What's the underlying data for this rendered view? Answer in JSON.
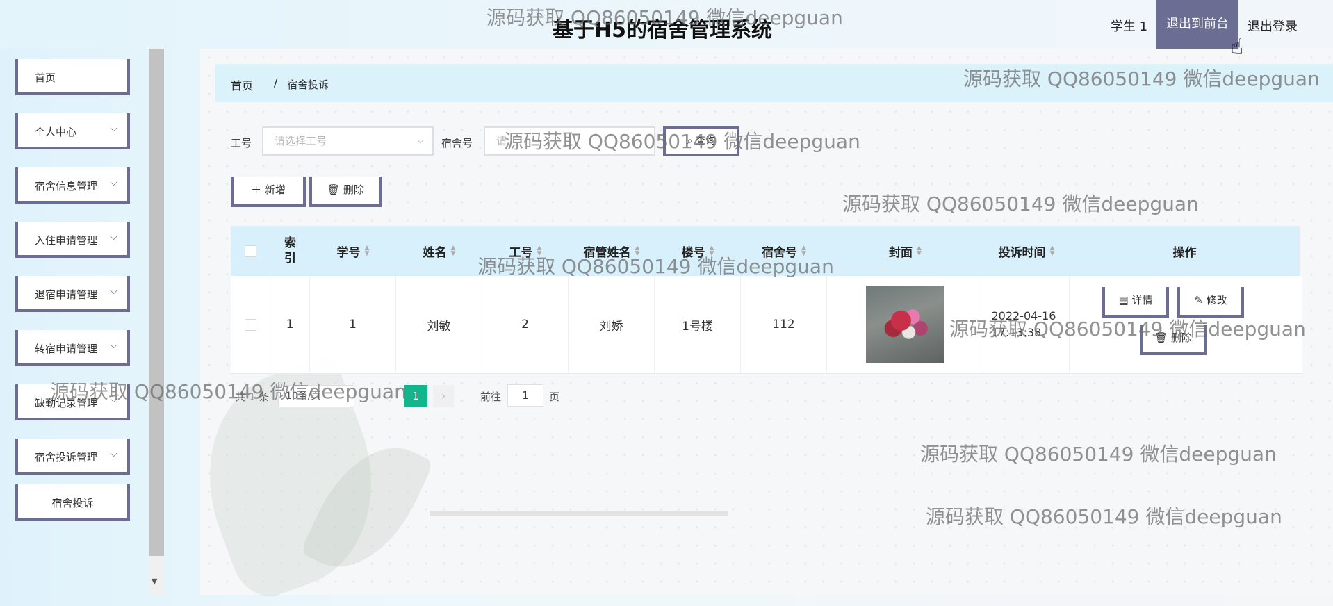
{
  "header": {
    "title": "基于H5的宿舍管理系统",
    "user": "学生 1",
    "front_label": "退出到前台",
    "logout_label": "退出登录"
  },
  "sidebar": {
    "items": [
      {
        "label": "首页",
        "has_chevron": false
      },
      {
        "label": "个人中心",
        "has_chevron": true
      },
      {
        "label": "宿舍信息管理",
        "has_chevron": true
      },
      {
        "label": "入住申请管理",
        "has_chevron": true
      },
      {
        "label": "退宿申请管理",
        "has_chevron": true
      },
      {
        "label": "转宿申请管理",
        "has_chevron": true
      },
      {
        "label": "缺勤记录管理",
        "has_chevron": true
      },
      {
        "label": "宿舍投诉管理",
        "has_chevron": true
      }
    ],
    "sub_item": "宿舍投诉"
  },
  "breadcrumb": {
    "home": "首页",
    "sep": "/",
    "current": "宿舍投诉"
  },
  "search": {
    "gonghao_label": "工号",
    "gonghao_placeholder": "请选择工号",
    "sushe_label": "宿舍号",
    "sushe_placeholder": "请",
    "query_label": "查询"
  },
  "toolbar": {
    "add_label": "新增",
    "delete_label": "删除"
  },
  "table": {
    "columns": [
      "索引",
      "学号",
      "姓名",
      "工号",
      "宿管姓名",
      "楼号",
      "宿舍号",
      "封面",
      "投诉时间",
      "操作"
    ],
    "sortable": [
      false,
      true,
      true,
      true,
      true,
      true,
      true,
      true,
      true,
      false
    ],
    "rows": [
      {
        "index": "1",
        "xuehao": "1",
        "name": "刘敏",
        "gonghao": "2",
        "suguan": "刘娇",
        "louhao": "1号楼",
        "sushe": "112",
        "time": "2022-04-16 17:13:38"
      }
    ],
    "actions": {
      "detail": "详情",
      "edit": "修改",
      "delete": "删除"
    }
  },
  "pagination": {
    "total": "共 1 条",
    "page_size": "10条/页",
    "current": "1",
    "goto": "前往",
    "page_input": "1",
    "page_unit": "页"
  },
  "watermark": "源码获取 QQ86050149 微信deepguan",
  "colors": {
    "accent": "#6b6e92",
    "header_bg": "#d8f0fb",
    "pager_active": "#13b58c"
  }
}
